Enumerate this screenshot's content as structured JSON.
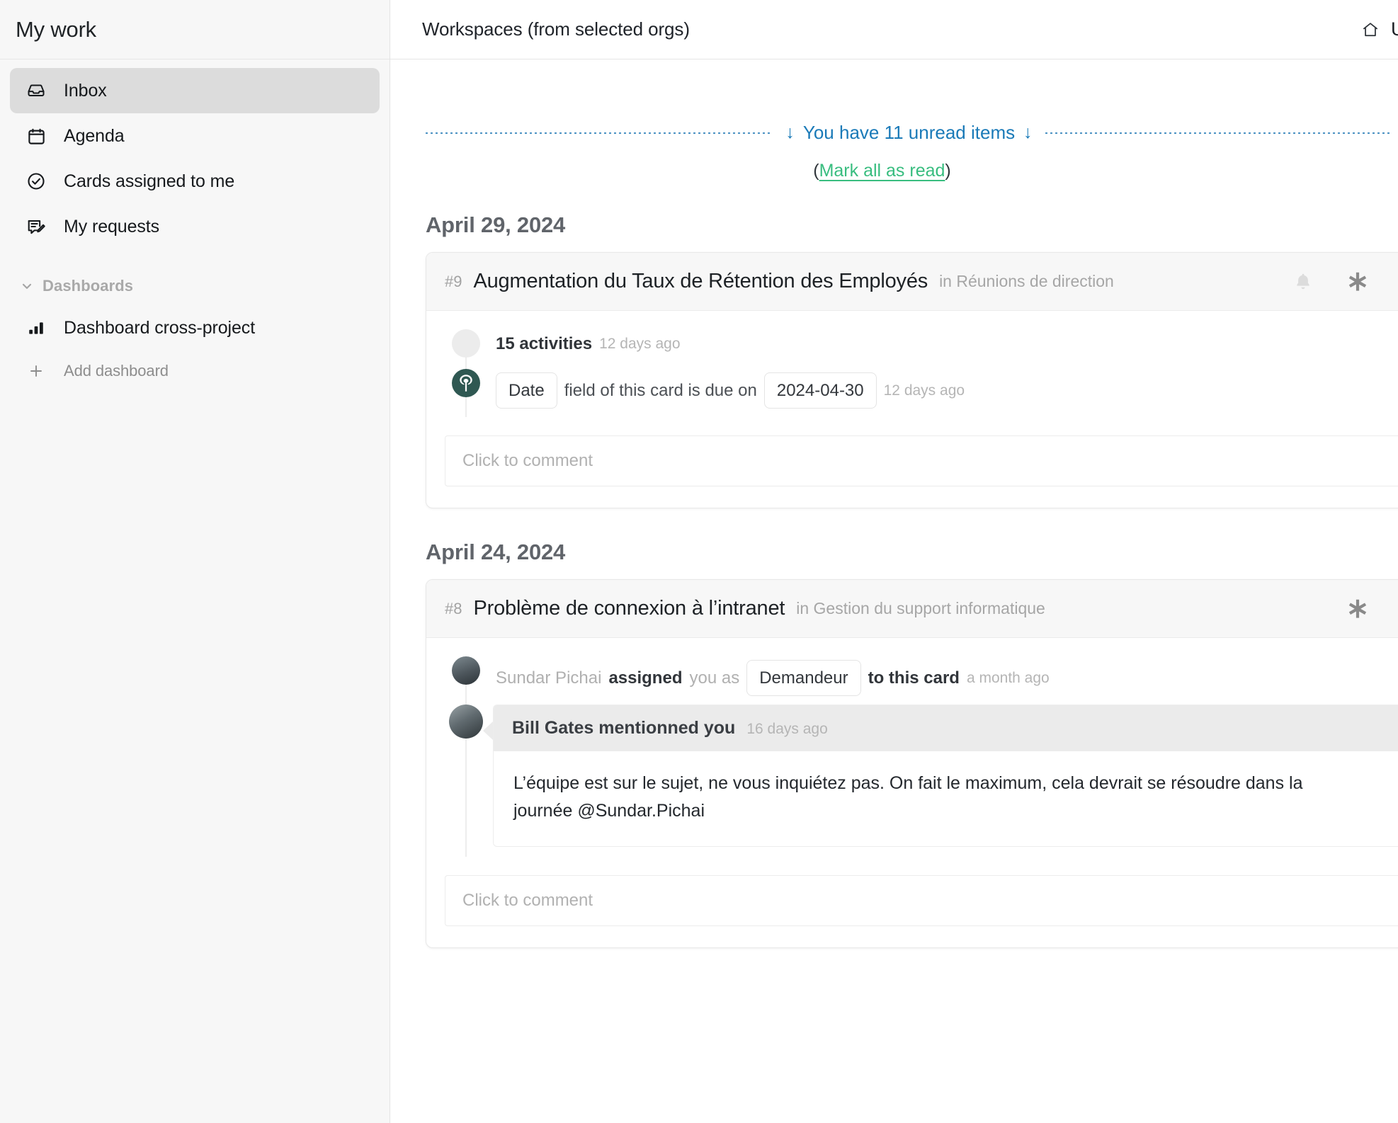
{
  "sidebar": {
    "title": "My work",
    "items": [
      {
        "label": "Inbox",
        "icon": "inbox-icon",
        "active": true
      },
      {
        "label": "Agenda",
        "icon": "calendar-icon",
        "active": false
      },
      {
        "label": "Cards assigned to me",
        "icon": "check-circle-icon",
        "active": false
      },
      {
        "label": "My requests",
        "icon": "request-edit-icon",
        "active": false
      }
    ],
    "section": {
      "label": "Dashboards",
      "expanded": true
    },
    "dashboard_item": {
      "label": "Dashboard cross-project",
      "icon": "bar-chart-icon"
    },
    "add_dashboard": {
      "label": "Add dashboard",
      "icon": "plus-icon"
    }
  },
  "header": {
    "title": "Workspaces (from selected orgs)",
    "right_label": "Use",
    "home_icon": "home-icon"
  },
  "unread": {
    "text": "You have 11 unread items",
    "count": 11,
    "arrow_left": "↓",
    "arrow_right": "↓",
    "open_paren": "(",
    "mark_all_label": "Mark all as read",
    "close_paren": ")",
    "accent_blue": "#1a7ab8",
    "accent_green": "#38bd7f"
  },
  "groups": [
    {
      "date": "April 29, 2024",
      "card": {
        "number": "#9",
        "title": "Augmentation du Taux de Rétention des Employés",
        "location": "in Réunions de direction",
        "has_bell": true,
        "bell_icon": "bell-icon",
        "asterisk_icon": "asterisk-icon",
        "activities": [
          {
            "type": "count",
            "avatar": "blank-avatar",
            "label": "15 activities",
            "ago": "12 days ago"
          },
          {
            "type": "field-change",
            "avatar": "tree-logo-avatar",
            "chip_field": "Date",
            "text_mid": "field of this card is due on",
            "chip_value": "2024-04-30",
            "ago": "12 days ago"
          }
        ],
        "comment_placeholder": "Click to comment"
      }
    },
    {
      "date": "April 24, 2024",
      "card": {
        "number": "#8",
        "title": "Problème de connexion à l’intranet",
        "location": "in Gestion du support informatique",
        "has_bell": false,
        "asterisk_icon": "asterisk-icon",
        "assignment": {
          "avatar": "sundar-pichai-avatar",
          "actor": "Sundar Pichai",
          "verb": "assigned",
          "object": "you as",
          "role_chip": "Demandeur",
          "tail": "to this card",
          "ago": "a month ago"
        },
        "mention": {
          "avatar": "bill-gates-avatar",
          "title": "Bill Gates mentionned you",
          "ago": "16 days ago",
          "body": "L’équipe est sur le sujet, ne vous inquiétez pas. On fait le maximum, cela devrait se résoudre dans la journée @Sundar.Pichai"
        },
        "comment_placeholder": "Click to comment"
      }
    }
  ]
}
